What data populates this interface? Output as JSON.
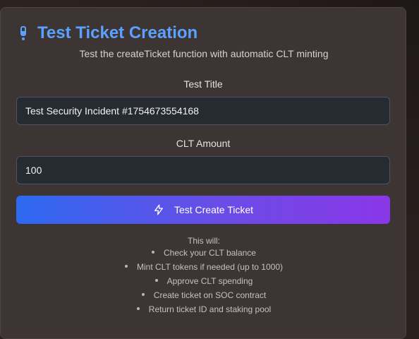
{
  "header": {
    "title": "Test Ticket Creation",
    "subtitle": "Test the createTicket function with automatic CLT minting",
    "icon": "test-tube-icon",
    "accent_color": "#5aa2ff"
  },
  "form": {
    "title_label": "Test Title",
    "title_value": "Test Security Incident #1754673554168",
    "amount_label": "CLT Amount",
    "amount_value": "100"
  },
  "button": {
    "label": "Test Create Ticket",
    "icon": "bolt-icon",
    "gradient_start": "#2d69f1",
    "gradient_end": "#8a37e8"
  },
  "info": {
    "heading": "This will:",
    "items": [
      "Check your CLT balance",
      "Mint CLT tokens if needed (up to 1000)",
      "Approve CLT spending",
      "Create ticket on SOC contract",
      "Return ticket ID and staking pool"
    ]
  }
}
